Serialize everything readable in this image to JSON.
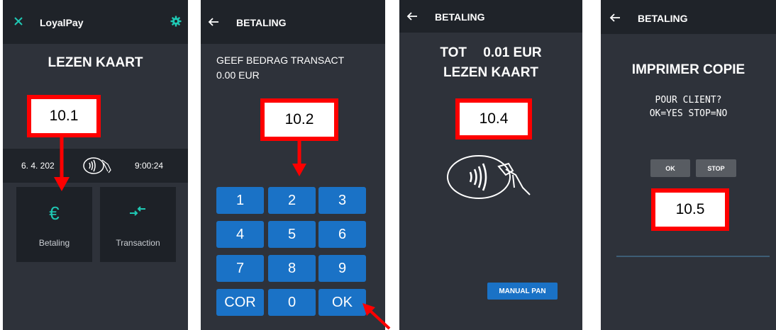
{
  "screen1": {
    "app_title": "LoyalPay",
    "close_icon": "close-icon",
    "settings_icon": "gear-icon",
    "heading": "LEZEN KAART",
    "callout": "10.1",
    "date": "6. 4. 202",
    "time": "9:00:24",
    "tiles": [
      {
        "label": "Betaling",
        "icon": "euro-icon",
        "glyph": "€"
      },
      {
        "label": "Transaction",
        "icon": "transfer-arrows-icon"
      }
    ],
    "accent": "#1fc8b4"
  },
  "screen2": {
    "title": "BETALING",
    "prompt_line1": "GEEF BEDRAG TRANSACT",
    "prompt_line2": "0.00 EUR",
    "callout": "10.2",
    "keys": [
      "1",
      "2",
      "3",
      "4",
      "5",
      "6",
      "7",
      "8",
      "9",
      "COR",
      "0",
      "OK"
    ]
  },
  "screen3": {
    "title": "BETALING",
    "total_label": "TOT",
    "total_amount": "0.01 EUR",
    "heading": "LEZEN KAART",
    "callout": "10.4",
    "manual_pan": "MANUAL PAN"
  },
  "screen4": {
    "title": "BETALING",
    "heading": "IMPRIMER COPIE",
    "line1": "POUR CLIENT?",
    "line2": "OK=YES STOP=NO",
    "ok": "OK",
    "stop": "STOP",
    "callout": "10.5"
  },
  "colors": {
    "panel": "#2e323a",
    "appbar": "#1f2329",
    "key": "#1a72c6",
    "callout_border": "#ff0000"
  }
}
